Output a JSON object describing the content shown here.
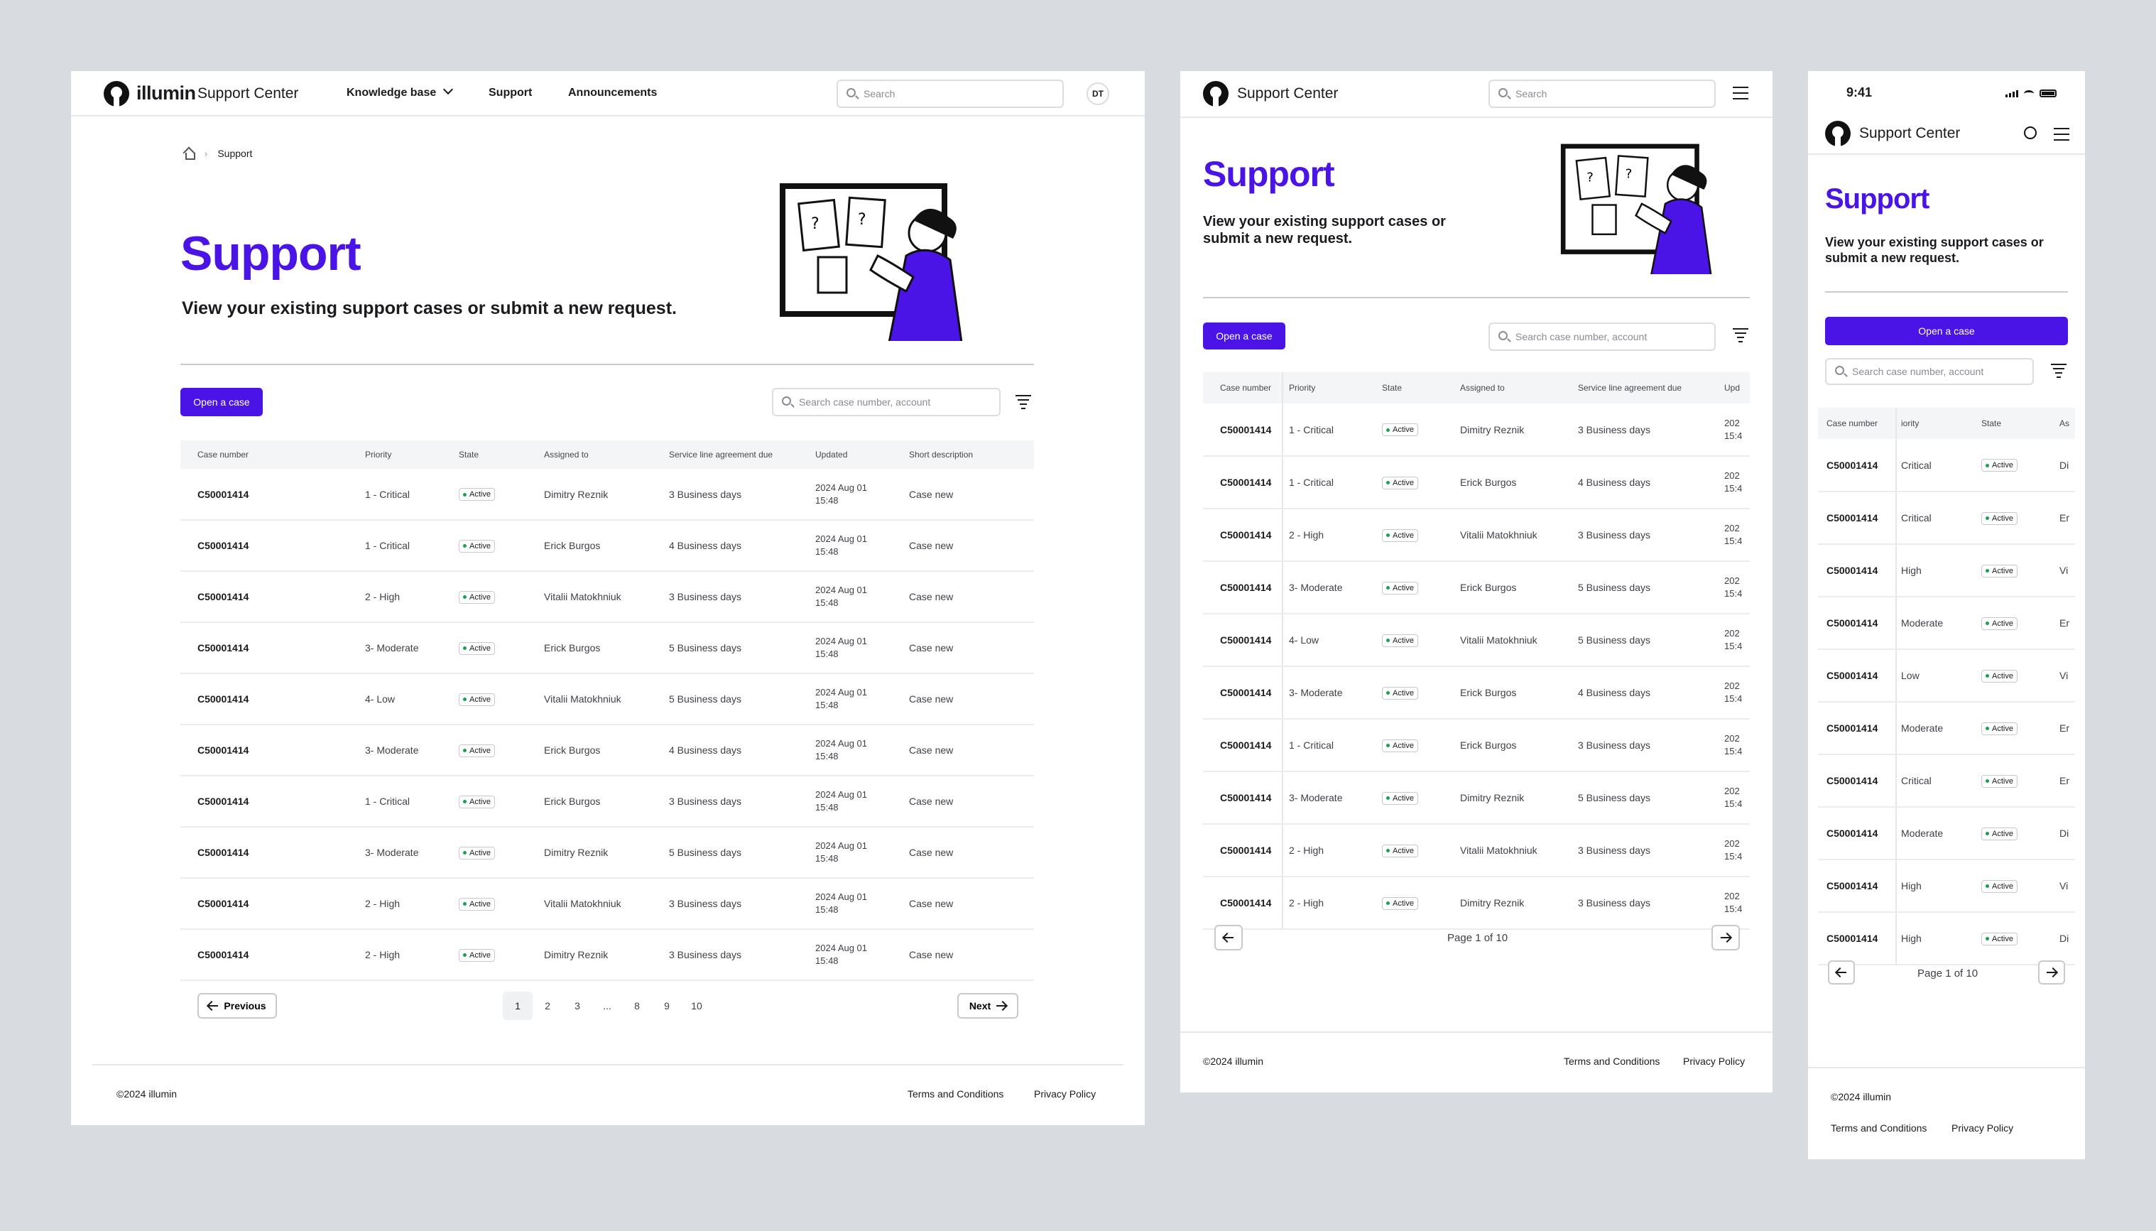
{
  "brand": {
    "name": "illumin",
    "product": "Support Center"
  },
  "nav": {
    "knowledge_base": "Knowledge base",
    "support": "Support",
    "announcements": "Announcements"
  },
  "header_search": {
    "placeholder": "Search"
  },
  "user": {
    "initials": "DT"
  },
  "breadcrumb": {
    "current": "Support"
  },
  "page": {
    "title": "Support",
    "subtitle": "View your existing support cases or submit a new request."
  },
  "actions": {
    "open_case": "Open a case",
    "table_search_placeholder": "Search case number, account"
  },
  "table": {
    "columns": [
      "Case number",
      "Priority",
      "State",
      "Assigned to",
      "Service line agreement due",
      "Updated",
      "Short description"
    ],
    "rows_desktop": [
      [
        "C50001414",
        "1 - Critical",
        "Active",
        "Dimitry Reznik",
        "3 Business days",
        "2024 Aug 01",
        "15:48",
        "Case new"
      ],
      [
        "C50001414",
        "1 - Critical",
        "Active",
        "Erick Burgos",
        "4 Business days",
        "2024 Aug 01",
        "15:48",
        "Case new"
      ],
      [
        "C50001414",
        "2 - High",
        "Active",
        "Vitalii Matokhniuk",
        "3 Business days",
        "2024 Aug 01",
        "15:48",
        "Case new"
      ],
      [
        "C50001414",
        "3- Moderate",
        "Active",
        "Erick Burgos",
        "5 Business days",
        "2024 Aug 01",
        "15:48",
        "Case new"
      ],
      [
        "C50001414",
        "4- Low",
        "Active",
        "Vitalii Matokhniuk",
        "5 Business days",
        "2024 Aug 01",
        "15:48",
        "Case new"
      ],
      [
        "C50001414",
        "3- Moderate",
        "Active",
        "Erick Burgos",
        "4 Business days",
        "2024 Aug 01",
        "15:48",
        "Case new"
      ],
      [
        "C50001414",
        "1 - Critical",
        "Active",
        "Erick Burgos",
        "3 Business days",
        "2024 Aug 01",
        "15:48",
        "Case new"
      ],
      [
        "C50001414",
        "3- Moderate",
        "Active",
        "Dimitry Reznik",
        "5 Business days",
        "2024 Aug 01",
        "15:48",
        "Case new"
      ],
      [
        "C50001414",
        "2 - High",
        "Active",
        "Vitalii Matokhniuk",
        "3 Business days",
        "2024 Aug 01",
        "15:48",
        "Case new"
      ],
      [
        "C50001414",
        "2 - High",
        "Active",
        "Dimitry Reznik",
        "3 Business days",
        "2024 Aug 01",
        "15:48",
        "Case new"
      ]
    ],
    "rows_tablet": [
      [
        "C50001414",
        "1 - Critical",
        "Active",
        "Dimitry Reznik",
        "3 Business days",
        "202",
        "15:4"
      ],
      [
        "C50001414",
        "1 - Critical",
        "Active",
        "Erick Burgos",
        "4 Business days",
        "202",
        "15:4"
      ],
      [
        "C50001414",
        "2 - High",
        "Active",
        "Vitalii Matokhniuk",
        "3 Business days",
        "202",
        "15:4"
      ],
      [
        "C50001414",
        "3- Moderate",
        "Active",
        "Erick Burgos",
        "5 Business days",
        "202",
        "15:4"
      ],
      [
        "C50001414",
        "4- Low",
        "Active",
        "Vitalii Matokhniuk",
        "5 Business days",
        "202",
        "15:4"
      ],
      [
        "C50001414",
        "3- Moderate",
        "Active",
        "Erick Burgos",
        "4 Business days",
        "202",
        "15:4"
      ],
      [
        "C50001414",
        "1 - Critical",
        "Active",
        "Erick Burgos",
        "3 Business days",
        "202",
        "15:4"
      ],
      [
        "C50001414",
        "3- Moderate",
        "Active",
        "Dimitry Reznik",
        "5 Business days",
        "202",
        "15:4"
      ],
      [
        "C50001414",
        "2 - High",
        "Active",
        "Vitalii Matokhniuk",
        "3 Business days",
        "202",
        "15:4"
      ],
      [
        "C50001414",
        "2 - High",
        "Active",
        "Dimitry Reznik",
        "3 Business days",
        "202",
        "15:4"
      ]
    ],
    "rows_mobile": [
      [
        "C50001414",
        "Critical",
        "Active",
        "Di"
      ],
      [
        "C50001414",
        "Critical",
        "Active",
        "Er"
      ],
      [
        "C50001414",
        "High",
        "Active",
        "Vi"
      ],
      [
        "C50001414",
        "Moderate",
        "Active",
        "Er"
      ],
      [
        "C50001414",
        "Low",
        "Active",
        "Vi"
      ],
      [
        "C50001414",
        "Moderate",
        "Active",
        "Er"
      ],
      [
        "C50001414",
        "Critical",
        "Active",
        "Er"
      ],
      [
        "C50001414",
        "Moderate",
        "Active",
        "Di"
      ],
      [
        "C50001414",
        "High",
        "Active",
        "Vi"
      ],
      [
        "C50001414",
        "High",
        "Active",
        "Di"
      ]
    ],
    "tablet_cols": [
      "Case number",
      "Priority",
      "State",
      "Assigned to",
      "Service line agreement due",
      "Upd"
    ],
    "mobile_cols": [
      "Case number",
      "iority",
      "State",
      "As"
    ]
  },
  "pagination": {
    "previous": "Previous",
    "next": "Next",
    "pages": [
      "1",
      "2",
      "3",
      "...",
      "8",
      "9",
      "10"
    ],
    "current": "1",
    "page_info": "Page 1 of 10"
  },
  "footer": {
    "copyright": "©2024 illumin",
    "terms": "Terms and Conditions",
    "privacy": "Privacy Policy"
  },
  "mobile_status": {
    "time": "9:41"
  },
  "colors": {
    "accent": "#4a14e6",
    "active_dot": "#1aa050"
  }
}
